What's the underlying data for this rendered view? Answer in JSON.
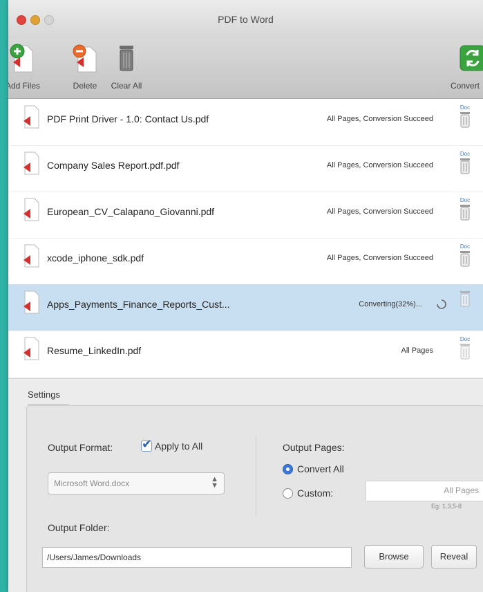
{
  "window": {
    "title": "PDF to Word"
  },
  "toolbar": {
    "add_label": "Add Files",
    "delete_label": "Delete",
    "clear_label": "Clear All",
    "convert_label": "Convert"
  },
  "files": [
    {
      "name": "PDF Print Driver - 1.0: Contact Us.pdf",
      "status": "All Pages, Conversion Succeed",
      "tag": "Doc"
    },
    {
      "name": "Company Sales Report.pdf.pdf",
      "status": "All Pages, Conversion Succeed",
      "tag": "Doc"
    },
    {
      "name": "European_CV_Calapano_Giovanni.pdf",
      "status": "All Pages, Conversion Succeed",
      "tag": "Doc"
    },
    {
      "name": "xcode_iphone_sdk.pdf",
      "status": "All Pages, Conversion Succeed",
      "tag": "Doc"
    },
    {
      "name": "Apps_Payments_Finance_Reports_Cust...",
      "status": "Converting(32%)...",
      "tag": ""
    },
    {
      "name": "Resume_LinkedIn.pdf",
      "status": "All Pages",
      "tag": "Doc"
    }
  ],
  "settings": {
    "title": "Settings",
    "output_format_label": "Output Format:",
    "apply_all_label": "Apply to All",
    "format_value": "Microsoft Word.docx",
    "output_pages_label": "Output Pages:",
    "convert_all_label": "Convert All",
    "custom_label": "Custom:",
    "pages_placeholder": "All Pages",
    "pages_example": "Eg: 1,3,5-8",
    "output_folder_label": "Output Folder:",
    "folder_value": "/Users/James/Downloads",
    "browse_label": "Browse",
    "reveal_label": "Reveal"
  },
  "colors": {
    "background": "#2fb3a7",
    "selection": "#c8dff2",
    "pdf_red": "#d3302f",
    "convert_green": "#3aa33f"
  }
}
